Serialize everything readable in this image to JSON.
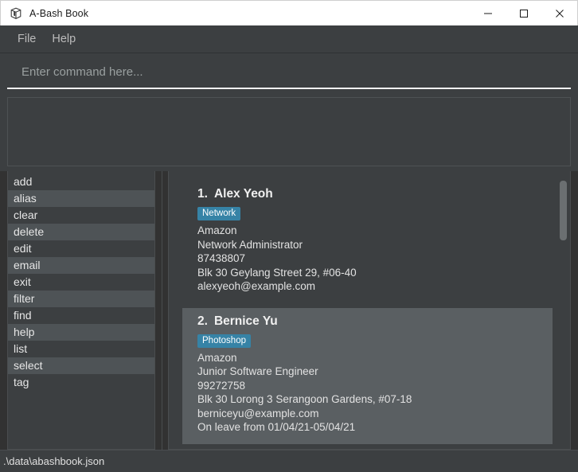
{
  "window": {
    "title": "A-Bash Book",
    "icon": "app-book-icon",
    "controls": {
      "minimize": "minimize-icon",
      "maximize": "maximize-icon",
      "close": "close-icon"
    }
  },
  "menubar": {
    "items": [
      {
        "label": "File"
      },
      {
        "label": "Help"
      }
    ]
  },
  "command": {
    "value": "",
    "placeholder": "Enter command here..."
  },
  "result": {
    "text": ""
  },
  "command_list": {
    "items": [
      {
        "label": "add"
      },
      {
        "label": "alias"
      },
      {
        "label": "clear"
      },
      {
        "label": "delete"
      },
      {
        "label": "edit"
      },
      {
        "label": "email"
      },
      {
        "label": "exit"
      },
      {
        "label": "filter"
      },
      {
        "label": "find"
      },
      {
        "label": "help"
      },
      {
        "label": "list"
      },
      {
        "label": "select"
      },
      {
        "label": "tag"
      }
    ]
  },
  "contacts": [
    {
      "index": "1.",
      "name": "Alex Yeoh",
      "tags": [
        "Network"
      ],
      "company": "Amazon",
      "job": "Network Administrator",
      "phone": "87438807",
      "address": "Blk 30 Geylang Street 29, #06-40",
      "email": "alexyeoh@example.com",
      "leave": "",
      "selected": false
    },
    {
      "index": "2.",
      "name": "Bernice Yu",
      "tags": [
        "Photoshop"
      ],
      "company": "Amazon",
      "job": "Junior Software Engineer",
      "phone": "99272758",
      "address": "Blk 30 Lorong 3 Serangoon Gardens, #07-18",
      "email": "berniceyu@example.com",
      "leave": "On leave from 01/04/21-05/04/21",
      "selected": true
    }
  ],
  "statusbar": {
    "path": ".\\data\\abashbook.json"
  },
  "colors": {
    "window_bg": "#3c3f41",
    "panel_bg": "#3c3f41",
    "outer_bg": "#323232",
    "selected_row": "#4e5356",
    "selected_card": "#5a5f62",
    "tag_badge": "#3683a6",
    "text_primary": "#e6e6e6",
    "text_placeholder": "#9aa0a0",
    "titlebar_bg": "#ffffff",
    "scrollbar_thumb": "#6b6f71"
  }
}
